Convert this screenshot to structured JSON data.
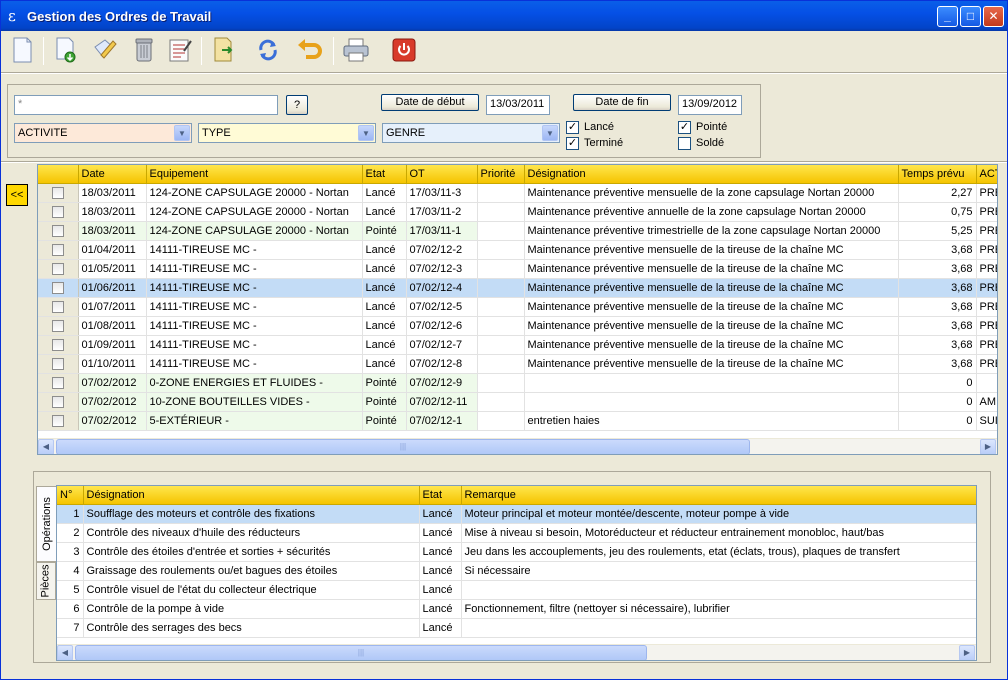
{
  "window": {
    "title": "Gestion des Ordres de Travail",
    "controls": {
      "minimize": "_",
      "maximize": "□",
      "close": "✕"
    }
  },
  "toolbar": {
    "tools": [
      "new-document-icon",
      "import-icon",
      "edit-icon",
      "delete-bin-icon",
      "report-icon",
      "export-icon",
      "refresh-icon",
      "undo-icon",
      "print-icon",
      "power-icon"
    ]
  },
  "filters": {
    "search_value": "*",
    "help_label": "?",
    "date_debut_label": "Date de début",
    "date_debut_value": "13/03/2011",
    "date_fin_label": "Date de fin",
    "date_fin_value": "13/09/2012",
    "activite": {
      "value": "ACTIVITE",
      "color": "#fde9d9"
    },
    "type": {
      "value": "TYPE",
      "color": "#fffbd6"
    },
    "genre": {
      "value": "GENRE",
      "color": "#e6f0fb"
    },
    "checks": [
      {
        "label": "Lancé",
        "checked": true
      },
      {
        "label": "Terminé",
        "checked": true
      },
      {
        "label": "Pointé",
        "checked": true
      },
      {
        "label": "Soldé",
        "checked": false
      }
    ]
  },
  "collapse_label": "<<",
  "ot_grid": {
    "columns": [
      "",
      "Date",
      "Equipement",
      "Etat",
      "OT",
      "Priorité",
      "Désignation",
      "Temps prévu",
      "ACT"
    ],
    "rows": [
      [
        "18/03/2011",
        "124-ZONE CAPSULAGE 20000 - Nortan",
        "Lancé",
        "17/03/11-3",
        "",
        "Maintenance préventive mensuelle de la zone capsulage Nortan 20000",
        "2,27",
        "PRE"
      ],
      [
        "18/03/2011",
        "124-ZONE CAPSULAGE 20000 - Nortan",
        "Lancé",
        "17/03/11-2",
        "",
        "Maintenance préventive annuelle de la zone capsulage Nortan 20000",
        "0,75",
        "PRE"
      ],
      [
        "18/03/2011",
        "124-ZONE CAPSULAGE 20000 - Nortan",
        "Pointé",
        "17/03/11-1",
        "",
        "Maintenance préventive trimestrielle de la zone capsulage Nortan 20000",
        "5,25",
        "PRE"
      ],
      [
        "01/04/2011",
        "14111-TIREUSE MC -",
        "Lancé",
        "07/02/12-2",
        "",
        "Maintenance préventive mensuelle de la tireuse de la chaîne MC",
        "3,68",
        "PRE"
      ],
      [
        "01/05/2011",
        "14111-TIREUSE MC -",
        "Lancé",
        "07/02/12-3",
        "",
        "Maintenance préventive mensuelle de la tireuse de la chaîne MC",
        "3,68",
        "PRE"
      ],
      [
        "01/06/2011",
        "14111-TIREUSE MC -",
        "Lancé",
        "07/02/12-4",
        "",
        "Maintenance préventive mensuelle de la tireuse de la chaîne MC",
        "3,68",
        "PRE"
      ],
      [
        "01/07/2011",
        "14111-TIREUSE MC -",
        "Lancé",
        "07/02/12-5",
        "",
        "Maintenance préventive mensuelle de la tireuse de la chaîne MC",
        "3,68",
        "PRE"
      ],
      [
        "01/08/2011",
        "14111-TIREUSE MC -",
        "Lancé",
        "07/02/12-6",
        "",
        "Maintenance préventive mensuelle de la tireuse de la chaîne MC",
        "3,68",
        "PRE"
      ],
      [
        "01/09/2011",
        "14111-TIREUSE MC -",
        "Lancé",
        "07/02/12-7",
        "",
        "Maintenance préventive mensuelle de la tireuse de la chaîne MC",
        "3,68",
        "PRE"
      ],
      [
        "01/10/2011",
        "14111-TIREUSE MC -",
        "Lancé",
        "07/02/12-8",
        "",
        "Maintenance préventive mensuelle de la tireuse de la chaîne MC",
        "3,68",
        "PRE"
      ],
      [
        "07/02/2012",
        "0-ZONE ENERGIES ET FLUIDES -",
        "Pointé",
        "07/02/12-9",
        "",
        "",
        "0",
        ""
      ],
      [
        "07/02/2012",
        "10-ZONE BOUTEILLES VIDES -",
        "Pointé",
        "07/02/12-11",
        "",
        "",
        "0",
        "AMI"
      ],
      [
        "07/02/2012",
        "5-EXTÉRIEUR -",
        "Pointé",
        "07/02/12-1",
        "",
        "entretien haies",
        "0",
        "SUI"
      ]
    ],
    "selected_row": 5
  },
  "tabs": [
    {
      "label": "Opérations",
      "active": true
    },
    {
      "label": "Pièces",
      "active": false
    }
  ],
  "ops_grid": {
    "columns": [
      "N°",
      "Désignation",
      "Etat",
      "Remarque"
    ],
    "rows": [
      [
        "1",
        "Soufflage des moteurs et contrôle des fixations",
        "Lancé",
        "Moteur principal et moteur montée/descente, moteur pompe à vide"
      ],
      [
        "2",
        "Contrôle des niveaux d'huile des réducteurs",
        "Lancé",
        "Mise à niveau si besoin, Motoréducteur et réducteur entrainement monobloc, haut/bas"
      ],
      [
        "3",
        "Contrôle des étoiles d'entrée et sorties + sécurités",
        "Lancé",
        "Jeu dans les accouplements, jeu des roulements, etat (éclats, trous), plaques de transfert"
      ],
      [
        "4",
        "Graissage des roulements ou/et bagues des étoiles",
        "Lancé",
        "Si nécessaire"
      ],
      [
        "5",
        "Contrôle visuel de l'état du collecteur électrique",
        "Lancé",
        ""
      ],
      [
        "6",
        "Contrôle de la pompe à vide",
        "Lancé",
        "Fonctionnement, filtre (nettoyer si nécessaire), lubrifier"
      ],
      [
        "7",
        "Contrôle des serrages des becs",
        "Lancé",
        ""
      ]
    ],
    "selected_row": 0
  }
}
